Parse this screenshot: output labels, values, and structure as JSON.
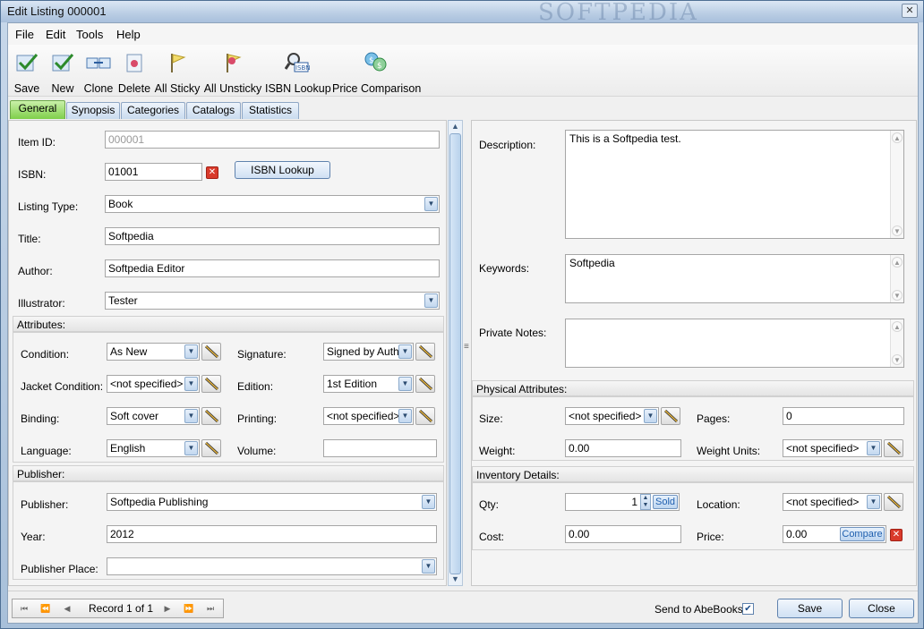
{
  "window": {
    "title": "Edit Listing 000001",
    "watermark": "SOFTPEDIA"
  },
  "menu": [
    "File",
    "Edit",
    "Tools",
    "Help"
  ],
  "toolbar": {
    "save": "Save",
    "new": "New",
    "clone": "Clone",
    "delete": "Delete",
    "all_sticky": "All Sticky",
    "all_unsticky": "All Unsticky",
    "isbn_lookup": "ISBN Lookup",
    "price_comparison": "Price Comparison"
  },
  "tabs": [
    "General",
    "Synopsis",
    "Categories",
    "Catalogs",
    "Statistics"
  ],
  "general": {
    "item_id": {
      "label": "Item ID:",
      "value": "000001"
    },
    "isbn": {
      "label": "ISBN:",
      "value": "01001",
      "button": "ISBN Lookup"
    },
    "listing_type": {
      "label": "Listing Type:",
      "value": "Book"
    },
    "title": {
      "label": "Title:",
      "value": "Softpedia"
    },
    "author": {
      "label": "Author:",
      "value": "Softpedia Editor"
    },
    "illustrator": {
      "label": "Illustrator:",
      "value": "Tester"
    }
  },
  "attributes": {
    "header": "Attributes:",
    "condition": {
      "label": "Condition:",
      "value": "As New"
    },
    "signature": {
      "label": "Signature:",
      "value": "Signed by Author"
    },
    "jacket_condition": {
      "label": "Jacket Condition:",
      "value": "<not specified>"
    },
    "edition": {
      "label": "Edition:",
      "value": "1st Edition"
    },
    "binding": {
      "label": "Binding:",
      "value": "Soft cover"
    },
    "printing": {
      "label": "Printing:",
      "value": "<not specified>"
    },
    "language": {
      "label": "Language:",
      "value": "English"
    },
    "volume": {
      "label": "Volume:",
      "value": ""
    }
  },
  "publisher_group": {
    "header": "Publisher:",
    "publisher": {
      "label": "Publisher:",
      "value": "Softpedia Publishing"
    },
    "year": {
      "label": "Year:",
      "value": "2012"
    },
    "place": {
      "label": "Publisher Place:",
      "value": ""
    }
  },
  "right": {
    "description": {
      "label": "Description:",
      "value": "This is a Softpedia test."
    },
    "keywords": {
      "label": "Keywords:",
      "value": "Softpedia"
    },
    "private_notes": {
      "label": "Private Notes:",
      "value": ""
    }
  },
  "physical": {
    "header": "Physical Attributes:",
    "size": {
      "label": "Size:",
      "value": "<not specified>"
    },
    "pages": {
      "label": "Pages:",
      "value": "0"
    },
    "weight": {
      "label": "Weight:",
      "value": "0.00"
    },
    "weight_units": {
      "label": "Weight Units:",
      "value": "<not specified>"
    }
  },
  "inventory": {
    "header": "Inventory Details:",
    "qty": {
      "label": "Qty:",
      "value": "1",
      "sold": "Sold"
    },
    "location": {
      "label": "Location:",
      "value": "<not specified>"
    },
    "cost": {
      "label": "Cost:",
      "value": "0.00"
    },
    "price": {
      "label": "Price:",
      "value": "0.00",
      "compare": "Compare"
    }
  },
  "footer": {
    "record": "Record 1 of 1",
    "send_to": "Send to AbeBooks:",
    "send_checked": true,
    "save": "Save",
    "close": "Close"
  },
  "colors": {
    "active_tab": "#7fcf4a",
    "accent": "#5f82ad",
    "delete_red": "#d93a2b"
  }
}
